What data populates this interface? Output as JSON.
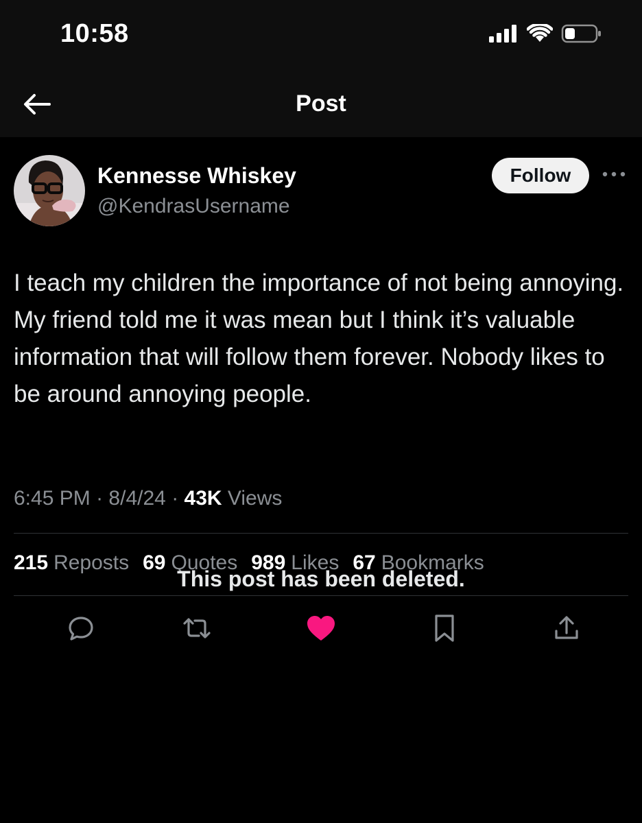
{
  "status_bar": {
    "time": "10:58"
  },
  "nav": {
    "title": "Post"
  },
  "post": {
    "author": {
      "display_name": "Kennesse Whiskey",
      "username": "@KendrasUsername"
    },
    "follow_label": "Follow",
    "text": "I teach my children the importance of not being annoying. My friend told me it was mean but I think it’s valuable information that will follow them forever. Nobody likes to be around annoying people.",
    "meta": {
      "time": "6:45 PM",
      "separator": "·",
      "date": "8/4/24",
      "views_count": "43K",
      "views_label": "Views"
    },
    "stats": {
      "reposts_count": "215",
      "reposts_label": "Reposts",
      "quotes_count": "69",
      "quotes_label": "Quotes",
      "likes_count": "989",
      "likes_label": "Likes",
      "bookmarks_count": "67",
      "bookmarks_label": "Bookmarks"
    },
    "actions": {
      "reply_icon": "reply-icon",
      "repost_icon": "repost-icon",
      "like_icon": "heart-icon",
      "bookmark_icon": "bookmark-icon",
      "share_icon": "share-icon"
    }
  },
  "deleted_notice": "This post has been deleted.",
  "colors": {
    "background": "#000000",
    "header_background": "#0e0e0e",
    "secondary_text": "#8b8f94",
    "like_active": "#f91880",
    "divider": "#2f3336",
    "follow_button": "#f1f1f1"
  }
}
